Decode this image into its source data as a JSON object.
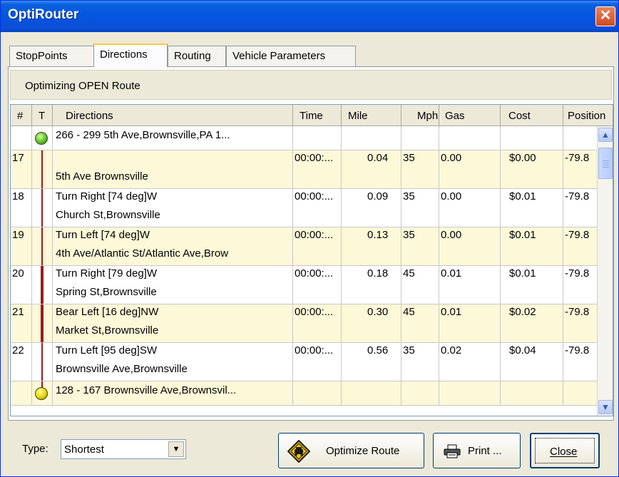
{
  "window": {
    "title": "OptiRouter",
    "close_glyph": "✕"
  },
  "tabs": [
    {
      "label": "StopPoints"
    },
    {
      "label": "Directions"
    },
    {
      "label": "Routing"
    },
    {
      "label": "Vehicle Parameters"
    }
  ],
  "route_status": "Optimizing OPEN Route",
  "columns": [
    "#",
    "T",
    "Directions",
    "Time",
    "Mile",
    "Mph",
    "Gas",
    "Cost",
    "Position"
  ],
  "rows": [
    {
      "num": "",
      "dir1": "266 - 299 5th Ave,Brownsville,PA 1...",
      "dir2": "",
      "time": "",
      "mile": "",
      "mph": "",
      "gas": "",
      "cost": "",
      "pos": ""
    },
    {
      "num": "17",
      "dir1": "",
      "dir2": "5th Ave Brownsville",
      "time": "00:00:...",
      "mile": "0.04",
      "mph": "35",
      "gas": "0.00",
      "cost": "$0.00",
      "pos": "-79.8"
    },
    {
      "num": "18",
      "dir1": "Turn Right  [74 deg]W",
      "dir2": "Church St,Brownsville",
      "time": "00:00:...",
      "mile": "0.09",
      "mph": "35",
      "gas": "0.00",
      "cost": "$0.01",
      "pos": "-79.8"
    },
    {
      "num": "19",
      "dir1": "Turn Left  [74 deg]W",
      "dir2": "4th Ave/Atlantic St/Atlantic Ave,Brow",
      "time": "00:00:...",
      "mile": "0.13",
      "mph": "35",
      "gas": "0.00",
      "cost": "$0.01",
      "pos": "-79.8"
    },
    {
      "num": "20",
      "dir1": "Turn Right  [79 deg]W",
      "dir2": "Spring St,Brownsville",
      "time": "00:00:...",
      "mile": "0.18",
      "mph": "45",
      "gas": "0.01",
      "cost": "$0.01",
      "pos": "-79.8"
    },
    {
      "num": "21",
      "dir1": "Bear Left  [16 deg]NW",
      "dir2": "Market St,Brownsville",
      "time": "00:00:...",
      "mile": "0.30",
      "mph": "45",
      "gas": "0.01",
      "cost": "$0.02",
      "pos": "-79.8"
    },
    {
      "num": "22",
      "dir1": "Turn Left  [95 deg]SW",
      "dir2": "Brownsville Ave,Brownsville",
      "time": "00:00:...",
      "mile": "0.56",
      "mph": "35",
      "gas": "0.02",
      "cost": "$0.04",
      "pos": "-79.8"
    },
    {
      "num": "",
      "dir1": "128 - 167 Brownsville Ave,Brownsvil...",
      "dir2": "",
      "time": "",
      "mile": "",
      "mph": "",
      "gas": "",
      "cost": "",
      "pos": ""
    }
  ],
  "footer": {
    "type_label": "Type:",
    "type_value": "Shortest",
    "optimize_label": "Optimize Route",
    "print_label": "Print ...",
    "close_label": "Close"
  },
  "icons": {
    "start_marker": "green-circle-icon",
    "end_marker": "yellow-circle-icon",
    "optimize": "car-road-sign-icon",
    "print": "printer-icon"
  },
  "colors": {
    "titlebar": "#0455e0",
    "alt_row": "#fcf8d8",
    "route_line": "#9b1b1b",
    "start_dot": "#5cbf2a",
    "end_dot": "#e6d400"
  }
}
